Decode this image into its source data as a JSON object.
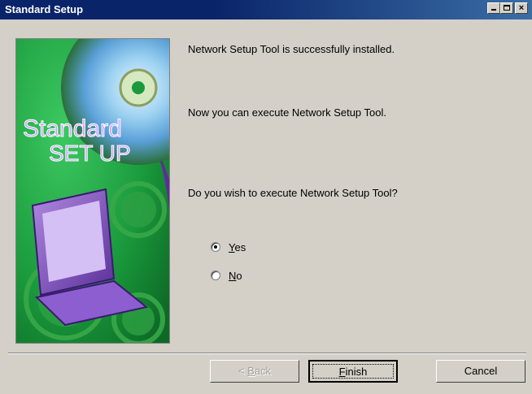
{
  "window": {
    "title": "Standard Setup",
    "controls": {
      "minimize": "minimize",
      "maximize": "maximize",
      "close": "×"
    }
  },
  "banner": {
    "line1": "Standard",
    "line2": "SET UP",
    "colors": {
      "green": "#1f8f3a",
      "purple": "#7a3fb0",
      "accent": "#c9a0ff"
    }
  },
  "content": {
    "message1": "Network Setup Tool is successfully installed.",
    "message2": "Now you can execute Network Setup Tool.",
    "question": "Do you wish to execute Network Setup Tool?",
    "options": [
      {
        "accel": "Y",
        "rest": "es",
        "checked": true
      },
      {
        "accel": "N",
        "rest": "o",
        "checked": false
      }
    ]
  },
  "buttons": {
    "back": {
      "accel": "B",
      "prefix": "< ",
      "rest": "ack"
    },
    "finish": {
      "accel": "F",
      "rest": "inish"
    },
    "cancel": "Cancel"
  }
}
